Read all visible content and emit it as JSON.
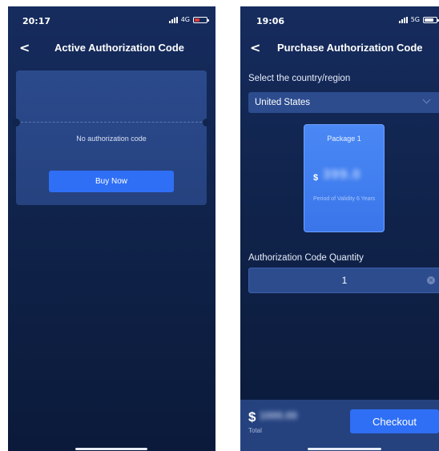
{
  "left_screen": {
    "status": {
      "time": "20:17",
      "network": "4G",
      "battery_color": "#e53935"
    },
    "nav": {
      "back": "<",
      "title": "Active Authorization Code"
    },
    "empty_state": {
      "message": "No authorization code",
      "buy_label": "Buy Now"
    }
  },
  "right_screen": {
    "status": {
      "time": "19:06",
      "network": "5G",
      "battery_color": "#ffffff"
    },
    "nav": {
      "back": "<",
      "title": "Purchase Authorization Code"
    },
    "region": {
      "label": "Select the country/region",
      "selected": "United States"
    },
    "package": {
      "name": "Package 1",
      "currency": "$",
      "price": "399.0",
      "validity": "Period of Validity 6 Years"
    },
    "quantity": {
      "label": "Authorization Code Quantity",
      "value": "1"
    },
    "footer": {
      "currency": "$",
      "amount": "1000.00",
      "total_label": "Total",
      "checkout_label": "Checkout"
    }
  },
  "colors": {
    "accent": "#2f6ff5",
    "background": "#10234b",
    "card": "#2b4a8c"
  }
}
